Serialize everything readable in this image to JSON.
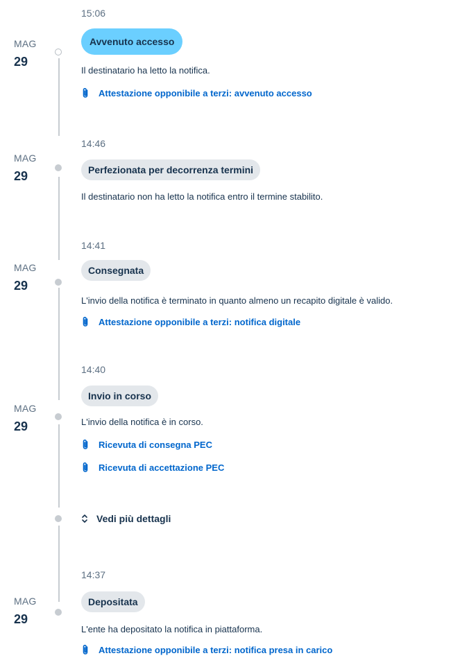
{
  "events": [
    {
      "month": "MAG",
      "day": "29",
      "time": "15:06",
      "status": "Avvenuto accesso",
      "description": "Il destinatario ha letto la notifica.",
      "links": [
        "Attestazione opponibile a terzi: avvenuto accesso"
      ]
    },
    {
      "month": "MAG",
      "day": "29",
      "time": "14:46",
      "status": "Perfezionata per decorrenza termini",
      "description": "Il destinatario non ha letto la notifica entro il termine stabilito.",
      "links": []
    },
    {
      "month": "MAG",
      "day": "29",
      "time": "14:41",
      "status": "Consegnata",
      "description": "L'invio della notifica è terminato in quanto almeno un recapito digitale è valido.",
      "links": [
        "Attestazione opponibile a terzi: notifica digitale"
      ]
    },
    {
      "month": "MAG",
      "day": "29",
      "time": "14:40",
      "status": "Invio in corso",
      "description": "L'invio della notifica è in corso.",
      "links": [
        "Ricevuta di consegna PEC",
        "Ricevuta di accettazione PEC"
      ]
    },
    {
      "month": "MAG",
      "day": "29",
      "time": "14:37",
      "status": "Depositata",
      "description": "L'ente ha depositato la notifica in piattaforma.",
      "links": [
        "Attestazione opponibile a terzi: notifica presa in carico"
      ]
    }
  ],
  "more_details_label": "Vedi più dettagli",
  "icons": {
    "attachment": "paperclip-icon",
    "expand": "chevron-up-down-icon"
  },
  "colors": {
    "active_badge": "#6bcfff",
    "badge": "#e3e7eb",
    "link": "#0066cc",
    "text": "#17324d",
    "muted": "#5c6f82",
    "timeline": "#c7ccd1"
  }
}
